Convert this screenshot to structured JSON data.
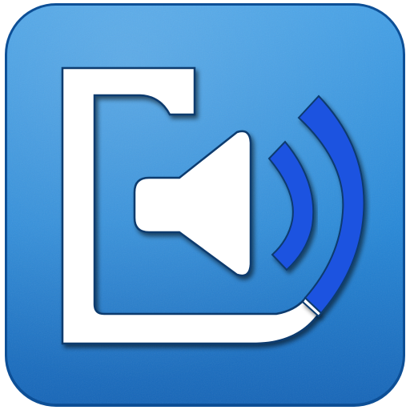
{
  "icon": {
    "name": "speaker-volume-app-icon",
    "glyph": "speaker-icon",
    "waves": "sound-waves-icon",
    "colors": {
      "tile_light": "#3f9ee6",
      "tile_mid": "#2688d8",
      "tile_dark": "#1565b8",
      "tile_edge": "#0d4f96",
      "glyph_fill": "#ffffff",
      "glyph_outline": "#0a3a6e",
      "wave_accent": "#1f52e0"
    }
  }
}
